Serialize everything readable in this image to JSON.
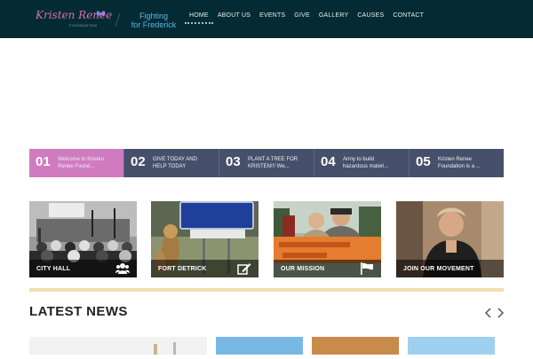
{
  "header": {
    "logo_script": "Kristen Renee",
    "logo_sub": "FOUNDATION",
    "tagline_line1": "Fighting",
    "tagline_line2": "for Frederick"
  },
  "nav": {
    "items": [
      {
        "label": "HOME",
        "active": true
      },
      {
        "label": "ABOUT US"
      },
      {
        "label": "EVENTS"
      },
      {
        "label": "GIVE"
      },
      {
        "label": "GALLERY"
      },
      {
        "label": "CAUSES"
      },
      {
        "label": "CONTACT"
      }
    ]
  },
  "slider_tabs": [
    {
      "num": "01",
      "text": "Welcome to Kristen Renee Found...",
      "active": true
    },
    {
      "num": "02",
      "text": "GIVE TODAY AND HELP TODAY"
    },
    {
      "num": "03",
      "text": "PLANT A TREE FOR KRISTEN!!! We..."
    },
    {
      "num": "04",
      "text": "Army to build hazardous materi..."
    },
    {
      "num": "05",
      "text": "Kristen Renee Foundation is a ..."
    }
  ],
  "tiles": [
    {
      "label": "CITY HALL",
      "icon": "group-icon"
    },
    {
      "label": "FORT DETRICK",
      "icon": "edit-icon"
    },
    {
      "label": "OUR MISSION",
      "icon": "flag-icon"
    },
    {
      "label": "JOIN OUR MOVEMENT",
      "icon": ""
    }
  ],
  "news": {
    "title": "LATEST NEWS"
  },
  "colors": {
    "header_bg": "#042b33",
    "accent_pink": "#d07ac0",
    "tab_bg": "#46506b",
    "divider": "#f1deb1",
    "tagline": "#57b8e3"
  }
}
